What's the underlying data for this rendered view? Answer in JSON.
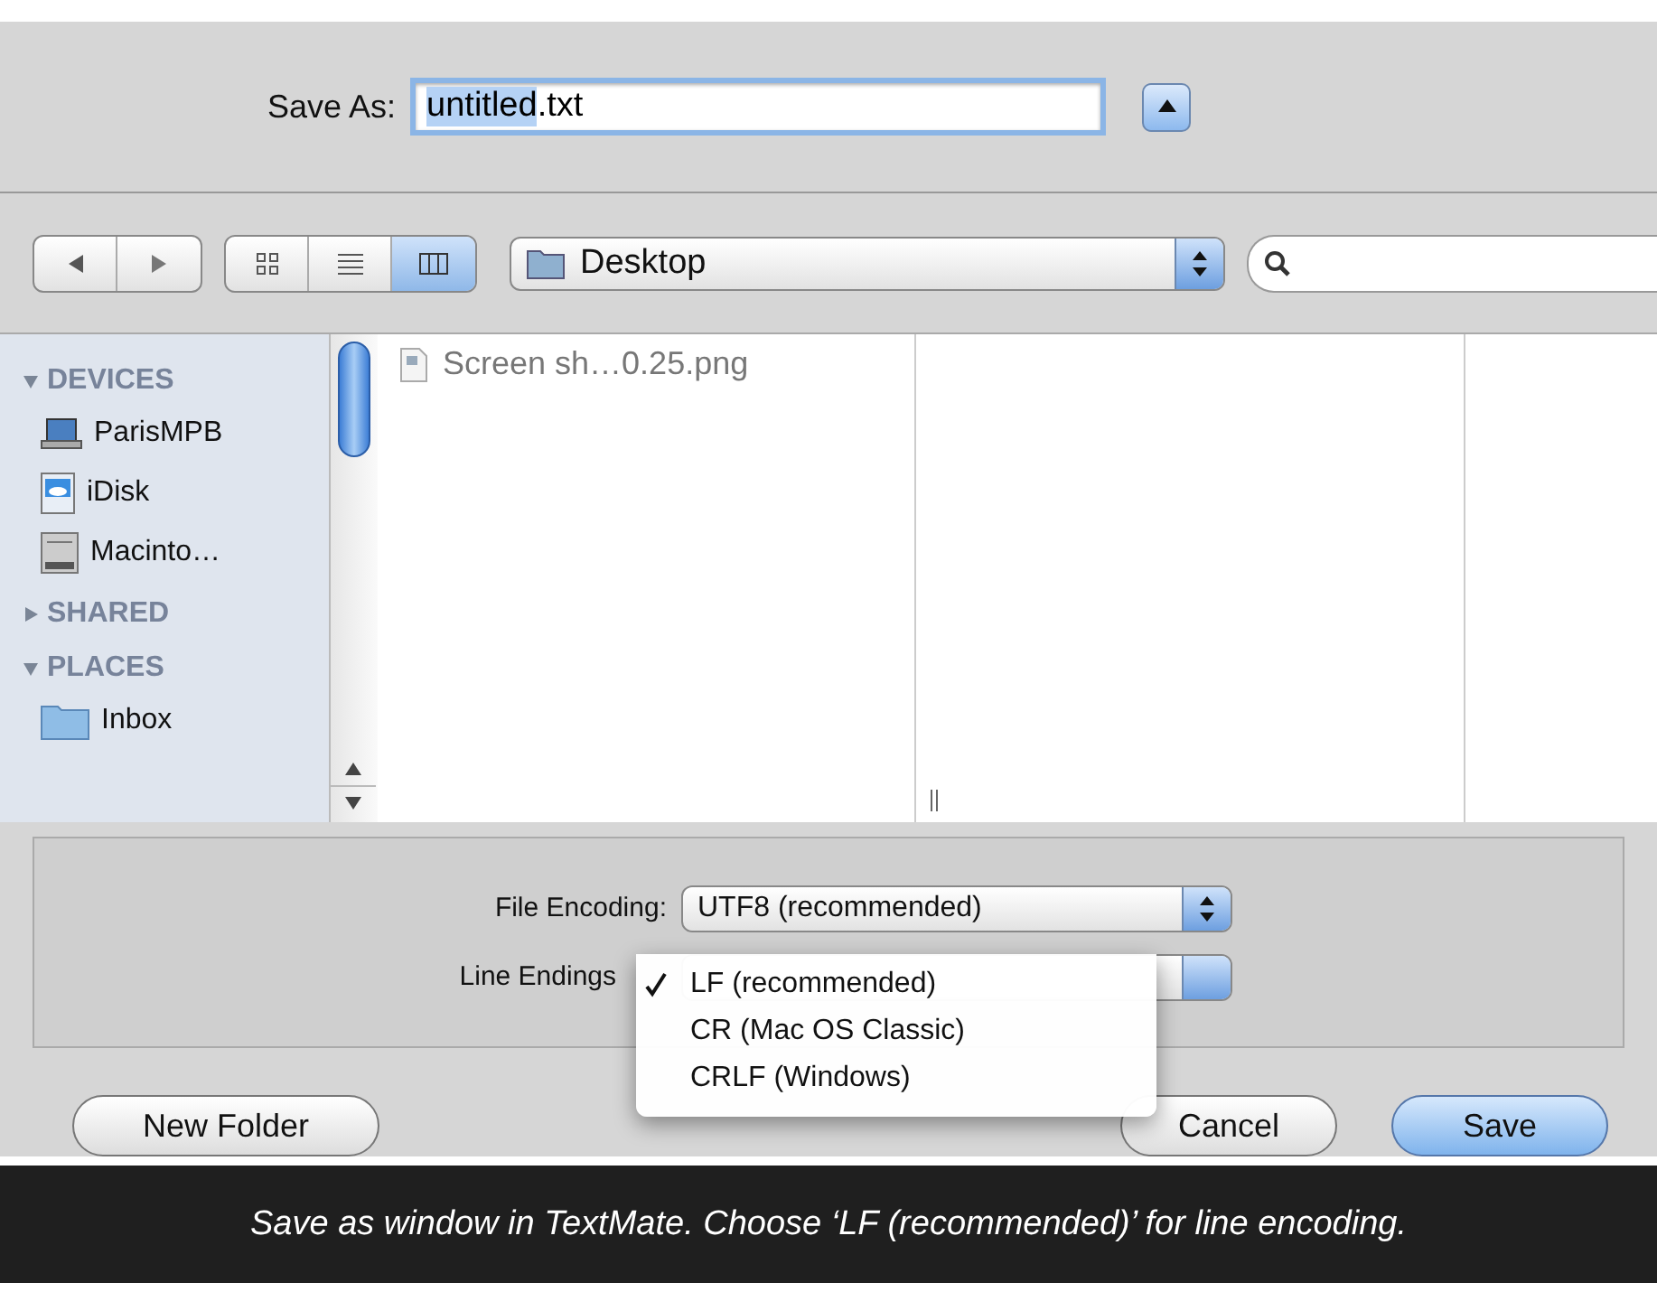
{
  "save_as": {
    "label": "Save As:",
    "value_selected": "untitled",
    "value_rest": ".txt",
    "expanded": true
  },
  "toolbar": {
    "view_modes": [
      {
        "kind": "icons",
        "selected": false
      },
      {
        "kind": "list",
        "selected": false
      },
      {
        "kind": "columns",
        "selected": true
      }
    ],
    "location": "Desktop"
  },
  "sidebar": {
    "sections": [
      {
        "title": "DEVICES",
        "expanded": true,
        "items": [
          {
            "label": "ParisMPB",
            "kind": "laptop"
          },
          {
            "label": "iDisk",
            "kind": "idisk"
          },
          {
            "label": "Macinto…",
            "kind": "drive"
          }
        ]
      },
      {
        "title": "SHARED",
        "expanded": false
      },
      {
        "title": "PLACES",
        "expanded": true,
        "items": [
          {
            "label": "Inbox",
            "kind": "folder"
          }
        ]
      }
    ]
  },
  "files": [
    {
      "name": "Screen sh…0.25.png"
    }
  ],
  "options": {
    "file_encoding": {
      "label": "File Encoding:",
      "value": "UTF8 (recommended)"
    },
    "line_endings": {
      "label": "Line Endings",
      "menu": [
        {
          "label": "LF (recommended)",
          "selected": true
        },
        {
          "label": "CR (Mac OS Classic)",
          "selected": false
        },
        {
          "label": "CRLF (Windows)",
          "selected": false
        }
      ]
    }
  },
  "buttons": [
    {
      "label": "New Folder",
      "default": false
    },
    {
      "label": "Cancel",
      "default": false
    },
    {
      "label": "Save",
      "default": true
    }
  ],
  "caption": "Save as window in TextMate. Choose ‘LF (recommended)’ for line encoding."
}
